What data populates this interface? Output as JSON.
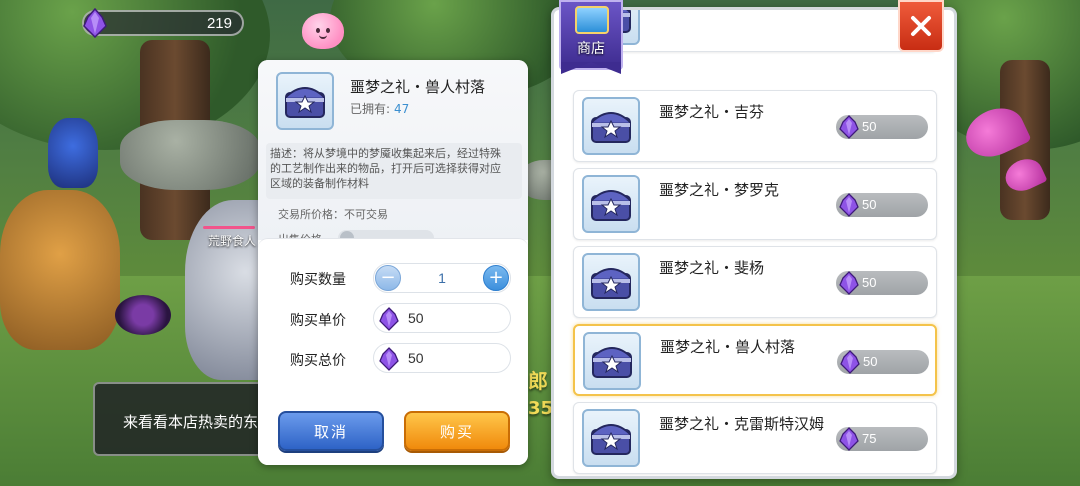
{
  "hud": {
    "currency_value": "219"
  },
  "scene": {
    "npc_name": "荒野食人",
    "bg_text_1": "郎",
    "bg_text_2": "35"
  },
  "dialog": {
    "text": "来看看本店热卖的东西"
  },
  "detail": {
    "title": "噩梦之礼・兽人村落",
    "owned_label": "已拥有:",
    "owned_value": "47",
    "description": "描述：将从梦境中的梦魇收集起来后，经过特殊的工艺制作出来的物品，打开后可选择获得对应区域的装备制作材料",
    "trade_price": "交易所价格：不可交易",
    "sell_price_label": "出售价格",
    "qty_label": "购买数量",
    "qty_value": "1",
    "qty_minus": "−",
    "qty_plus": "+",
    "unit_price_label": "购买单价",
    "unit_price": "50",
    "total_price_label": "购买总价",
    "total_price": "50",
    "cancel_label": "取消",
    "buy_label": "购买"
  },
  "shop": {
    "title": "商店",
    "close_icon": "close-icon",
    "items": [
      {
        "name": "噩梦之礼・吉芬",
        "price": "50",
        "selected": false
      },
      {
        "name": "噩梦之礼・梦罗克",
        "price": "50",
        "selected": false
      },
      {
        "name": "噩梦之礼・斐杨",
        "price": "50",
        "selected": false
      },
      {
        "name": "噩梦之礼・兽人村落",
        "price": "50",
        "selected": true
      },
      {
        "name": "噩梦之礼・克雷斯特汉姆",
        "price": "75",
        "selected": false
      }
    ]
  },
  "colors": {
    "buy_button": "#f08a0c",
    "cancel_button": "#2e63c6",
    "close_button": "#c82d13",
    "selected_border": "#f4c34a",
    "gem": "#7b3fd1"
  }
}
